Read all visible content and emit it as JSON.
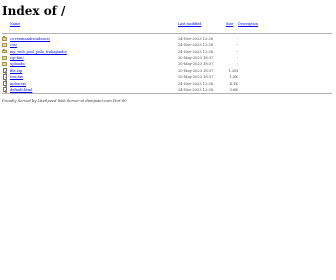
{
  "page": {
    "title": "Index of /"
  },
  "header": {
    "name": "Name",
    "last_modified": "Last modified",
    "size": "Size",
    "description": "Description"
  },
  "rows": [
    {
      "icon": "folder-icon",
      "name": "cs-reemandresidence/",
      "modified": "24-Nov-2023 12:38",
      "size": "-"
    },
    {
      "icon": "folder-icon",
      "name": "css/",
      "modified": "24-Nov-2023 12:38",
      "size": "-"
    },
    {
      "icon": "folder-icon",
      "name": "my_web_pool_pnlo_trabajando/",
      "modified": "24-Nov-2023 12:38",
      "size": "-"
    },
    {
      "icon": "folder-icon",
      "name": "cgi-bin/",
      "modified": "20-May-2023 18:37",
      "size": "-"
    },
    {
      "icon": "folder-icon",
      "name": "uploads/",
      "modified": "20-May-2023 18:37",
      "size": "-"
    },
    {
      "icon": "file-icon",
      "name": "file.zip",
      "modified": "20-May-2023 18:37",
      "size": "1.2M"
    },
    {
      "icon": "file-icon",
      "name": "test.txt",
      "modified": "20-May-2023 18:37",
      "size": "1.8K"
    },
    {
      "icon": "file-icon",
      "name": "index.txt",
      "modified": "24-Nov-2023 12:38",
      "size": "4.1K"
    },
    {
      "icon": "file-icon",
      "name": "default.html",
      "modified": "24-Nov-2023 12:38",
      "size": "3.6K"
    }
  ],
  "footer": {
    "text": "Proudly Served by LiteSpeed Web Server at dumpster.com Port 80"
  }
}
